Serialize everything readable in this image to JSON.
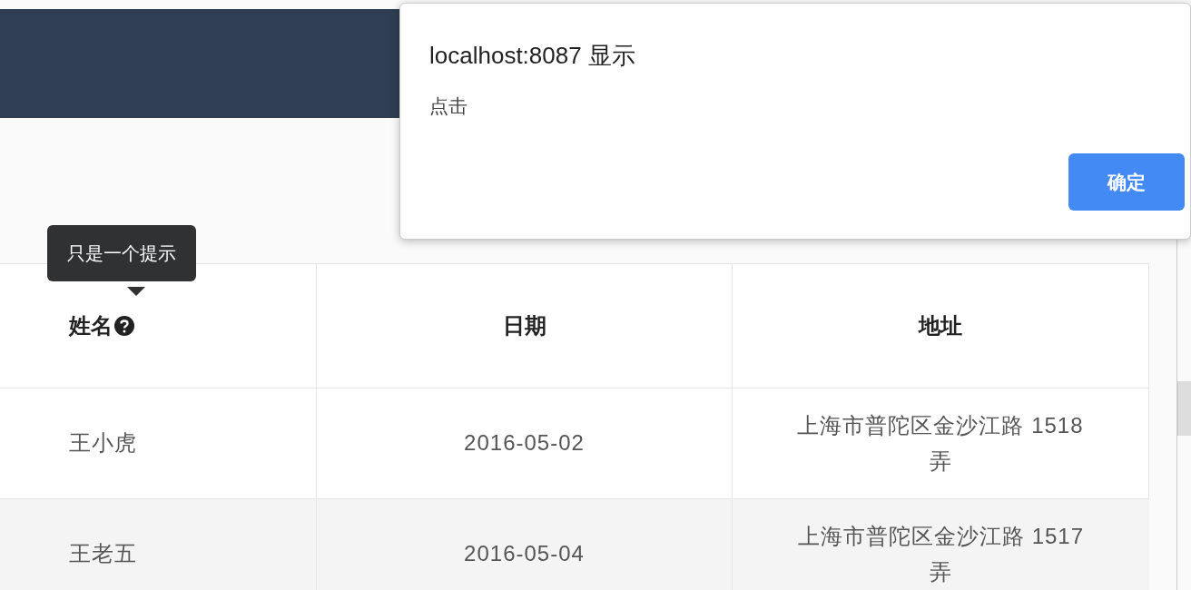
{
  "table": {
    "columns": [
      {
        "label": "姓名",
        "help_icon": true
      },
      {
        "label": "日期",
        "help_icon": false
      },
      {
        "label": "地址",
        "help_icon": false
      }
    ],
    "stripe": true,
    "rows": [
      {
        "cells": [
          "王小虎",
          "2016-05-02",
          "上海市普陀区金沙江路 1518 弄"
        ]
      },
      {
        "cells": [
          "王老五",
          "2016-05-04",
          "上海市普陀区金沙江路 1517 弄"
        ]
      }
    ]
  },
  "tooltip": {
    "text": "只是一个提示"
  },
  "dialog": {
    "title": "localhost:8087 显示",
    "message": "点击",
    "button": "确定"
  }
}
